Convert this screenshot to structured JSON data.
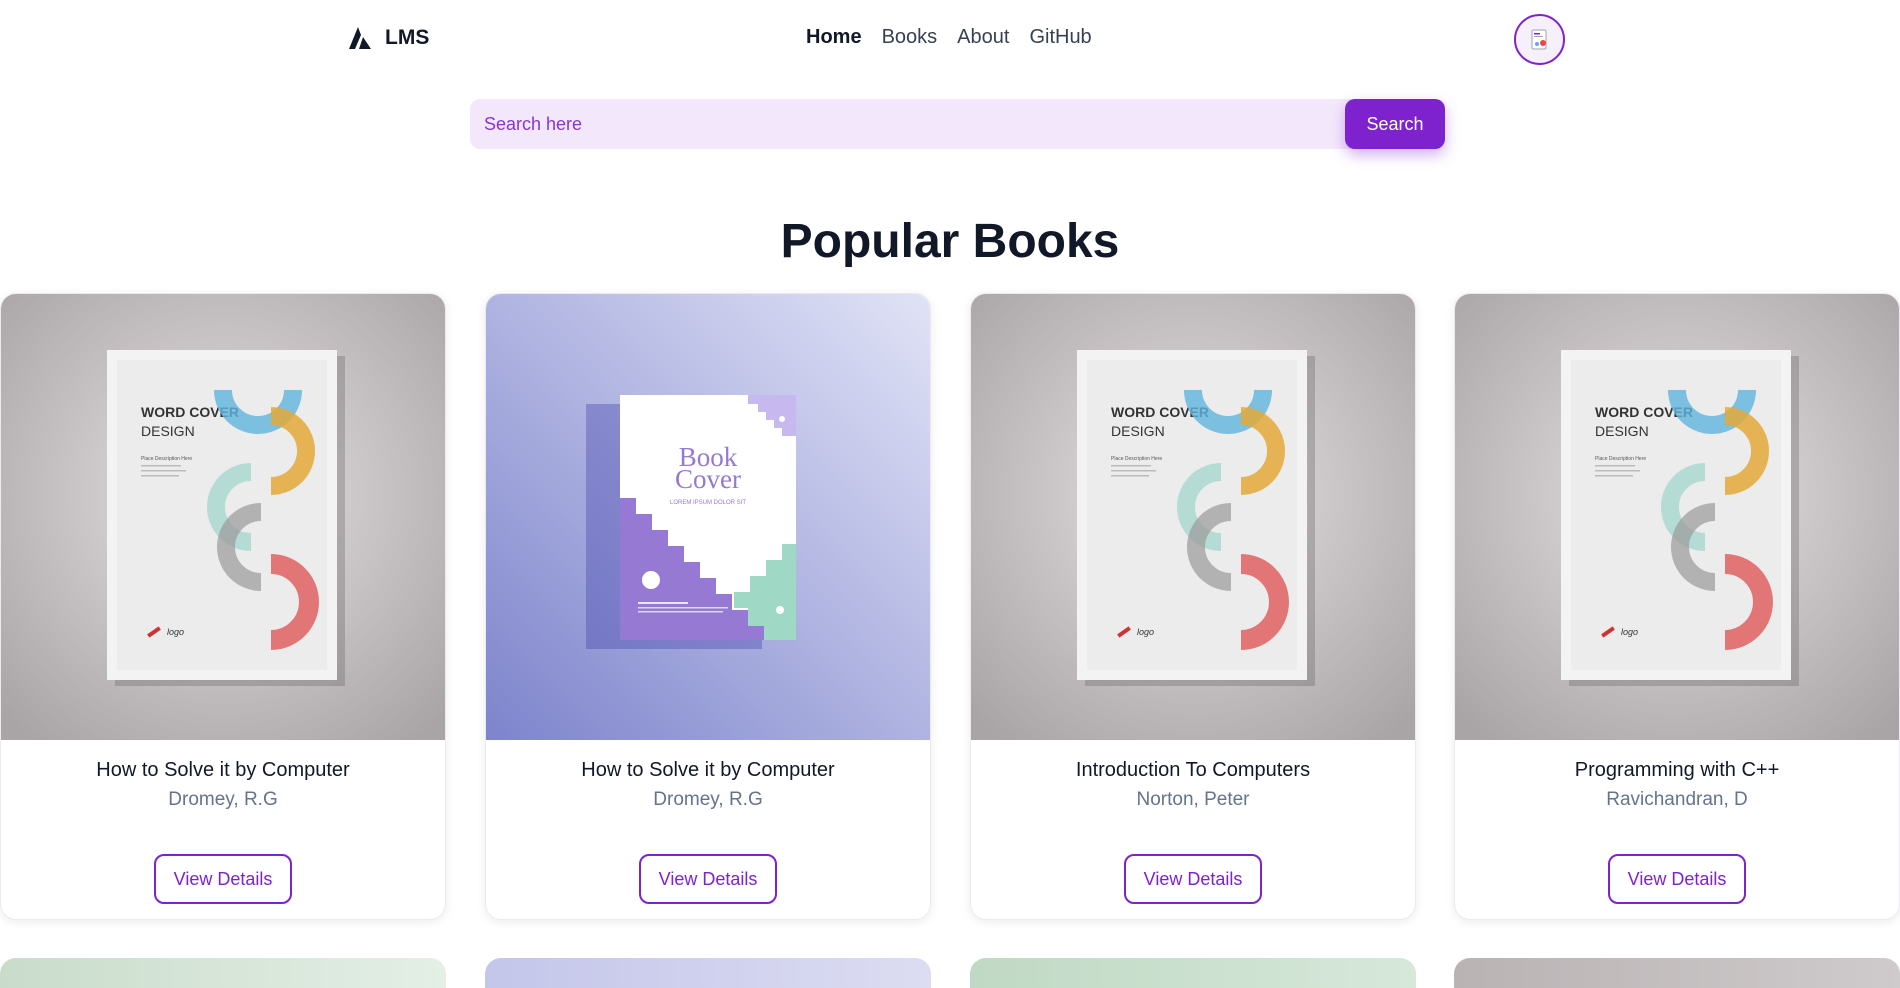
{
  "header": {
    "logo_text": "LMS",
    "nav": [
      {
        "label": "Home",
        "active": true
      },
      {
        "label": "Books",
        "active": false
      },
      {
        "label": "About",
        "active": false
      },
      {
        "label": "GitHub",
        "active": false
      }
    ],
    "avatar_icon": "user-avatar-icon"
  },
  "search": {
    "placeholder": "Search here",
    "value": "",
    "button_label": "Search"
  },
  "section": {
    "title": "Popular Books"
  },
  "books": [
    {
      "title": "How to Solve it by Computer",
      "author": "Dromey, R.G",
      "button": "View Details",
      "cover": "word-cover"
    },
    {
      "title": "How to Solve it by Computer",
      "author": "Dromey, R.G",
      "button": "View Details",
      "cover": "book-cover"
    },
    {
      "title": "Introduction To Computers",
      "author": "Norton, Peter",
      "button": "View Details",
      "cover": "word-cover"
    },
    {
      "title": "Programming with C++",
      "author": "Ravichandran, D",
      "button": "View Details",
      "cover": "word-cover"
    }
  ],
  "cover_text": {
    "word_title_1": "WORD COVER",
    "word_title_2": "DESIGN",
    "word_desc": "Place Description Here",
    "word_logo": "logo",
    "book_title_1": "Book",
    "book_title_2": "Cover",
    "book_sub": "LOREM IPSUM DOLOR SIT"
  },
  "colors": {
    "accent": "#7e22ce",
    "search_bg": "#f3e8fb",
    "author_text": "#64748b"
  }
}
